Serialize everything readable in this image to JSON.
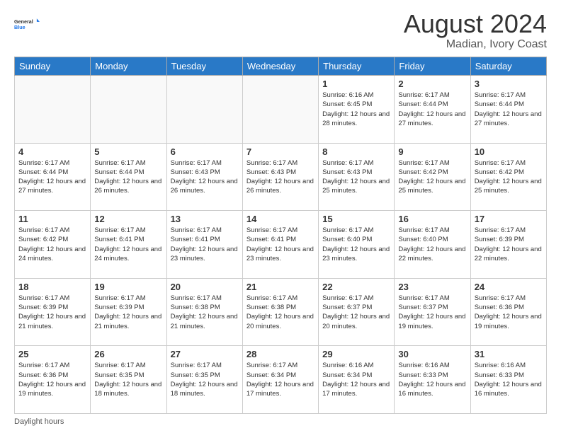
{
  "header": {
    "logo_line1": "General",
    "logo_line2": "Blue",
    "month_title": "August 2024",
    "location": "Madian, Ivory Coast"
  },
  "footer": {
    "note": "Daylight hours"
  },
  "days_of_week": [
    "Sunday",
    "Monday",
    "Tuesday",
    "Wednesday",
    "Thursday",
    "Friday",
    "Saturday"
  ],
  "weeks": [
    [
      {
        "day": "",
        "info": "",
        "empty": true
      },
      {
        "day": "",
        "info": "",
        "empty": true
      },
      {
        "day": "",
        "info": "",
        "empty": true
      },
      {
        "day": "",
        "info": "",
        "empty": true
      },
      {
        "day": "1",
        "info": "Sunrise: 6:16 AM\nSunset: 6:45 PM\nDaylight: 12 hours\nand 28 minutes.",
        "empty": false
      },
      {
        "day": "2",
        "info": "Sunrise: 6:17 AM\nSunset: 6:44 PM\nDaylight: 12 hours\nand 27 minutes.",
        "empty": false
      },
      {
        "day": "3",
        "info": "Sunrise: 6:17 AM\nSunset: 6:44 PM\nDaylight: 12 hours\nand 27 minutes.",
        "empty": false
      }
    ],
    [
      {
        "day": "4",
        "info": "Sunrise: 6:17 AM\nSunset: 6:44 PM\nDaylight: 12 hours\nand 27 minutes.",
        "empty": false
      },
      {
        "day": "5",
        "info": "Sunrise: 6:17 AM\nSunset: 6:44 PM\nDaylight: 12 hours\nand 26 minutes.",
        "empty": false
      },
      {
        "day": "6",
        "info": "Sunrise: 6:17 AM\nSunset: 6:43 PM\nDaylight: 12 hours\nand 26 minutes.",
        "empty": false
      },
      {
        "day": "7",
        "info": "Sunrise: 6:17 AM\nSunset: 6:43 PM\nDaylight: 12 hours\nand 26 minutes.",
        "empty": false
      },
      {
        "day": "8",
        "info": "Sunrise: 6:17 AM\nSunset: 6:43 PM\nDaylight: 12 hours\nand 25 minutes.",
        "empty": false
      },
      {
        "day": "9",
        "info": "Sunrise: 6:17 AM\nSunset: 6:42 PM\nDaylight: 12 hours\nand 25 minutes.",
        "empty": false
      },
      {
        "day": "10",
        "info": "Sunrise: 6:17 AM\nSunset: 6:42 PM\nDaylight: 12 hours\nand 25 minutes.",
        "empty": false
      }
    ],
    [
      {
        "day": "11",
        "info": "Sunrise: 6:17 AM\nSunset: 6:42 PM\nDaylight: 12 hours\nand 24 minutes.",
        "empty": false
      },
      {
        "day": "12",
        "info": "Sunrise: 6:17 AM\nSunset: 6:41 PM\nDaylight: 12 hours\nand 24 minutes.",
        "empty": false
      },
      {
        "day": "13",
        "info": "Sunrise: 6:17 AM\nSunset: 6:41 PM\nDaylight: 12 hours\nand 23 minutes.",
        "empty": false
      },
      {
        "day": "14",
        "info": "Sunrise: 6:17 AM\nSunset: 6:41 PM\nDaylight: 12 hours\nand 23 minutes.",
        "empty": false
      },
      {
        "day": "15",
        "info": "Sunrise: 6:17 AM\nSunset: 6:40 PM\nDaylight: 12 hours\nand 23 minutes.",
        "empty": false
      },
      {
        "day": "16",
        "info": "Sunrise: 6:17 AM\nSunset: 6:40 PM\nDaylight: 12 hours\nand 22 minutes.",
        "empty": false
      },
      {
        "day": "17",
        "info": "Sunrise: 6:17 AM\nSunset: 6:39 PM\nDaylight: 12 hours\nand 22 minutes.",
        "empty": false
      }
    ],
    [
      {
        "day": "18",
        "info": "Sunrise: 6:17 AM\nSunset: 6:39 PM\nDaylight: 12 hours\nand 21 minutes.",
        "empty": false
      },
      {
        "day": "19",
        "info": "Sunrise: 6:17 AM\nSunset: 6:39 PM\nDaylight: 12 hours\nand 21 minutes.",
        "empty": false
      },
      {
        "day": "20",
        "info": "Sunrise: 6:17 AM\nSunset: 6:38 PM\nDaylight: 12 hours\nand 21 minutes.",
        "empty": false
      },
      {
        "day": "21",
        "info": "Sunrise: 6:17 AM\nSunset: 6:38 PM\nDaylight: 12 hours\nand 20 minutes.",
        "empty": false
      },
      {
        "day": "22",
        "info": "Sunrise: 6:17 AM\nSunset: 6:37 PM\nDaylight: 12 hours\nand 20 minutes.",
        "empty": false
      },
      {
        "day": "23",
        "info": "Sunrise: 6:17 AM\nSunset: 6:37 PM\nDaylight: 12 hours\nand 19 minutes.",
        "empty": false
      },
      {
        "day": "24",
        "info": "Sunrise: 6:17 AM\nSunset: 6:36 PM\nDaylight: 12 hours\nand 19 minutes.",
        "empty": false
      }
    ],
    [
      {
        "day": "25",
        "info": "Sunrise: 6:17 AM\nSunset: 6:36 PM\nDaylight: 12 hours\nand 19 minutes.",
        "empty": false
      },
      {
        "day": "26",
        "info": "Sunrise: 6:17 AM\nSunset: 6:35 PM\nDaylight: 12 hours\nand 18 minutes.",
        "empty": false
      },
      {
        "day": "27",
        "info": "Sunrise: 6:17 AM\nSunset: 6:35 PM\nDaylight: 12 hours\nand 18 minutes.",
        "empty": false
      },
      {
        "day": "28",
        "info": "Sunrise: 6:17 AM\nSunset: 6:34 PM\nDaylight: 12 hours\nand 17 minutes.",
        "empty": false
      },
      {
        "day": "29",
        "info": "Sunrise: 6:16 AM\nSunset: 6:34 PM\nDaylight: 12 hours\nand 17 minutes.",
        "empty": false
      },
      {
        "day": "30",
        "info": "Sunrise: 6:16 AM\nSunset: 6:33 PM\nDaylight: 12 hours\nand 16 minutes.",
        "empty": false
      },
      {
        "day": "31",
        "info": "Sunrise: 6:16 AM\nSunset: 6:33 PM\nDaylight: 12 hours\nand 16 minutes.",
        "empty": false
      }
    ]
  ]
}
